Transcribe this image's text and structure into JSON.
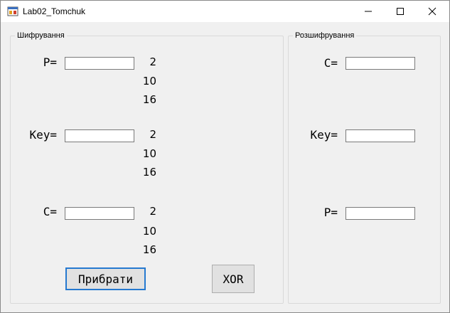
{
  "window": {
    "title": "Lab02_Tomchuk",
    "controls": {
      "minimize": "—",
      "maximize": "☐",
      "close": "✕"
    }
  },
  "encrypt_group": {
    "legend": "Шифрування",
    "p_label": "P=",
    "key_label": "Key=",
    "c_label": "C=",
    "p_bases": [
      "2",
      "10",
      "16"
    ],
    "key_bases": [
      "2",
      "10",
      "16"
    ],
    "c_bases": [
      "2",
      "10",
      "16"
    ],
    "clear_button": "Прибрати",
    "xor_button": "XOR"
  },
  "decrypt_group": {
    "legend": "Розшифрування",
    "c_label": "C=",
    "key_label": "Key=",
    "p_label": "P="
  },
  "fields": {
    "enc_p": "",
    "enc_key": "",
    "enc_c": "",
    "dec_c": "",
    "dec_key": "",
    "dec_p": ""
  },
  "colors": {
    "focus_border": "#2579d0",
    "button_bg": "#e1e1e1",
    "window_bg": "#f0f0f0"
  }
}
